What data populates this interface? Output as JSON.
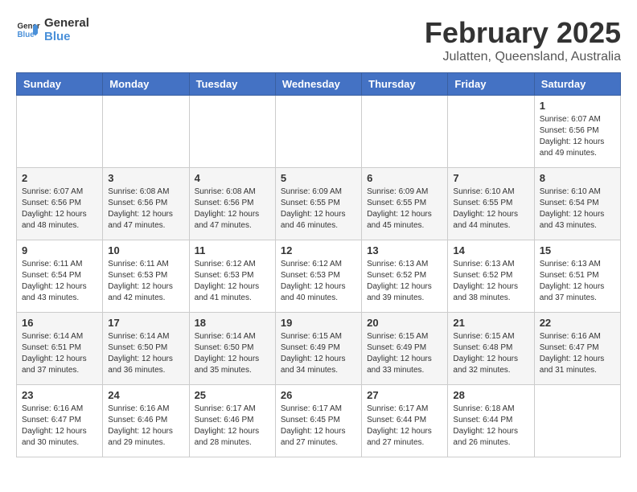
{
  "logo": {
    "line1": "General",
    "line2": "Blue"
  },
  "title": "February 2025",
  "subtitle": "Julatten, Queensland, Australia",
  "weekdays": [
    "Sunday",
    "Monday",
    "Tuesday",
    "Wednesday",
    "Thursday",
    "Friday",
    "Saturday"
  ],
  "weeks": [
    [
      {
        "date": "",
        "info": ""
      },
      {
        "date": "",
        "info": ""
      },
      {
        "date": "",
        "info": ""
      },
      {
        "date": "",
        "info": ""
      },
      {
        "date": "",
        "info": ""
      },
      {
        "date": "",
        "info": ""
      },
      {
        "date": "1",
        "info": "Sunrise: 6:07 AM\nSunset: 6:56 PM\nDaylight: 12 hours\nand 49 minutes."
      }
    ],
    [
      {
        "date": "2",
        "info": "Sunrise: 6:07 AM\nSunset: 6:56 PM\nDaylight: 12 hours\nand 48 minutes."
      },
      {
        "date": "3",
        "info": "Sunrise: 6:08 AM\nSunset: 6:56 PM\nDaylight: 12 hours\nand 47 minutes."
      },
      {
        "date": "4",
        "info": "Sunrise: 6:08 AM\nSunset: 6:56 PM\nDaylight: 12 hours\nand 47 minutes."
      },
      {
        "date": "5",
        "info": "Sunrise: 6:09 AM\nSunset: 6:55 PM\nDaylight: 12 hours\nand 46 minutes."
      },
      {
        "date": "6",
        "info": "Sunrise: 6:09 AM\nSunset: 6:55 PM\nDaylight: 12 hours\nand 45 minutes."
      },
      {
        "date": "7",
        "info": "Sunrise: 6:10 AM\nSunset: 6:55 PM\nDaylight: 12 hours\nand 44 minutes."
      },
      {
        "date": "8",
        "info": "Sunrise: 6:10 AM\nSunset: 6:54 PM\nDaylight: 12 hours\nand 43 minutes."
      }
    ],
    [
      {
        "date": "9",
        "info": "Sunrise: 6:11 AM\nSunset: 6:54 PM\nDaylight: 12 hours\nand 43 minutes."
      },
      {
        "date": "10",
        "info": "Sunrise: 6:11 AM\nSunset: 6:53 PM\nDaylight: 12 hours\nand 42 minutes."
      },
      {
        "date": "11",
        "info": "Sunrise: 6:12 AM\nSunset: 6:53 PM\nDaylight: 12 hours\nand 41 minutes."
      },
      {
        "date": "12",
        "info": "Sunrise: 6:12 AM\nSunset: 6:53 PM\nDaylight: 12 hours\nand 40 minutes."
      },
      {
        "date": "13",
        "info": "Sunrise: 6:13 AM\nSunset: 6:52 PM\nDaylight: 12 hours\nand 39 minutes."
      },
      {
        "date": "14",
        "info": "Sunrise: 6:13 AM\nSunset: 6:52 PM\nDaylight: 12 hours\nand 38 minutes."
      },
      {
        "date": "15",
        "info": "Sunrise: 6:13 AM\nSunset: 6:51 PM\nDaylight: 12 hours\nand 37 minutes."
      }
    ],
    [
      {
        "date": "16",
        "info": "Sunrise: 6:14 AM\nSunset: 6:51 PM\nDaylight: 12 hours\nand 37 minutes."
      },
      {
        "date": "17",
        "info": "Sunrise: 6:14 AM\nSunset: 6:50 PM\nDaylight: 12 hours\nand 36 minutes."
      },
      {
        "date": "18",
        "info": "Sunrise: 6:14 AM\nSunset: 6:50 PM\nDaylight: 12 hours\nand 35 minutes."
      },
      {
        "date": "19",
        "info": "Sunrise: 6:15 AM\nSunset: 6:49 PM\nDaylight: 12 hours\nand 34 minutes."
      },
      {
        "date": "20",
        "info": "Sunrise: 6:15 AM\nSunset: 6:49 PM\nDaylight: 12 hours\nand 33 minutes."
      },
      {
        "date": "21",
        "info": "Sunrise: 6:15 AM\nSunset: 6:48 PM\nDaylight: 12 hours\nand 32 minutes."
      },
      {
        "date": "22",
        "info": "Sunrise: 6:16 AM\nSunset: 6:47 PM\nDaylight: 12 hours\nand 31 minutes."
      }
    ],
    [
      {
        "date": "23",
        "info": "Sunrise: 6:16 AM\nSunset: 6:47 PM\nDaylight: 12 hours\nand 30 minutes."
      },
      {
        "date": "24",
        "info": "Sunrise: 6:16 AM\nSunset: 6:46 PM\nDaylight: 12 hours\nand 29 minutes."
      },
      {
        "date": "25",
        "info": "Sunrise: 6:17 AM\nSunset: 6:46 PM\nDaylight: 12 hours\nand 28 minutes."
      },
      {
        "date": "26",
        "info": "Sunrise: 6:17 AM\nSunset: 6:45 PM\nDaylight: 12 hours\nand 27 minutes."
      },
      {
        "date": "27",
        "info": "Sunrise: 6:17 AM\nSunset: 6:44 PM\nDaylight: 12 hours\nand 27 minutes."
      },
      {
        "date": "28",
        "info": "Sunrise: 6:18 AM\nSunset: 6:44 PM\nDaylight: 12 hours\nand 26 minutes."
      },
      {
        "date": "",
        "info": ""
      }
    ]
  ]
}
